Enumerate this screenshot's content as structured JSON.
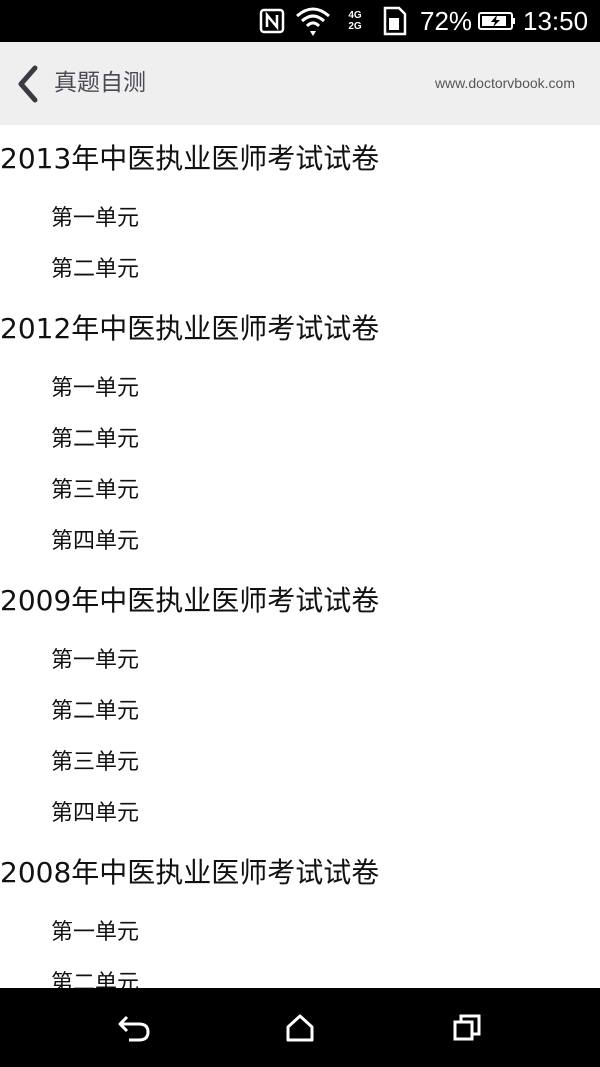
{
  "status_bar": {
    "network_top": "4G",
    "network_bottom": "2G",
    "battery_percent": "72%",
    "time": "13:50",
    "icons": [
      "nfc-icon",
      "wifi-icon",
      "signal-icon",
      "sim-icon",
      "battery-charging-icon"
    ]
  },
  "header": {
    "back_icon": "chevron-left-icon",
    "title": "真题自测",
    "site": "www.doctorvbook.com"
  },
  "exams": [
    {
      "title": "2013年中医执业医师考试试卷",
      "units": [
        "第一单元",
        "第二单元"
      ]
    },
    {
      "title": "2012年中医执业医师考试试卷",
      "units": [
        "第一单元",
        "第二单元",
        "第三单元",
        "第四单元"
      ]
    },
    {
      "title": "2009年中医执业医师考试试卷",
      "units": [
        "第一单元",
        "第二单元",
        "第三单元",
        "第四单元"
      ]
    },
    {
      "title": "2008年中医执业医师考试试卷",
      "units": [
        "第一单元",
        "第二单元"
      ]
    }
  ],
  "nav_bar": {
    "icons": [
      "back-icon",
      "home-icon",
      "recent-apps-icon"
    ]
  }
}
